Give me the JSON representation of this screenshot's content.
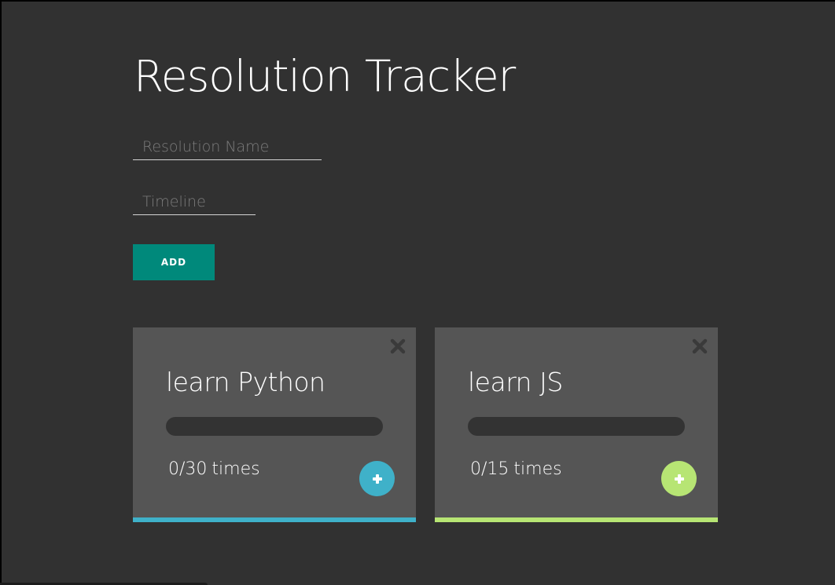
{
  "page": {
    "title": "Resolution Tracker",
    "background": "#313131"
  },
  "form": {
    "name_placeholder": "Resolution Name",
    "name_value": "",
    "timeline_placeholder": "Timeline",
    "timeline_value": "",
    "add_label": "ADD",
    "add_color": "#00897b"
  },
  "cards": [
    {
      "title": "learn Python",
      "done": "0",
      "separator": "/",
      "total": "30",
      "unit": "times",
      "progress": 0,
      "accent": "#3fb1c9",
      "close_icon": "close-icon",
      "plus_icon": "plus-icon"
    },
    {
      "title": "learn JS",
      "done": "0",
      "separator": "/",
      "total": "15",
      "unit": "times",
      "progress": 0,
      "accent": "#b7e574",
      "close_icon": "close-icon",
      "plus_icon": "plus-icon"
    }
  ],
  "colors": {
    "card_bg": "#555555",
    "track": "#333333",
    "close_icon": "#3a3a3a"
  }
}
